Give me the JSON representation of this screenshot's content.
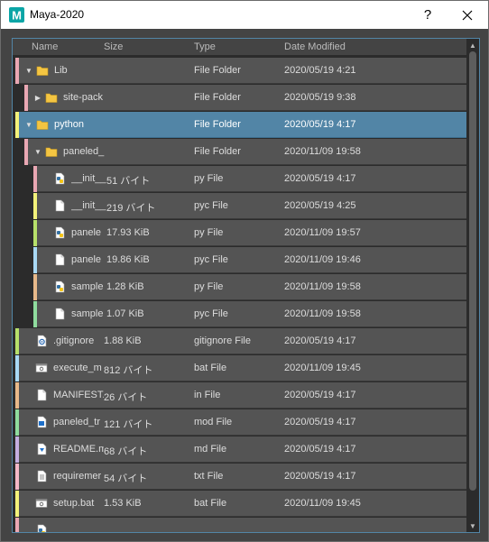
{
  "window": {
    "title": "Maya-2020",
    "help_label": "?",
    "app_icon_letter": "M"
  },
  "columns": {
    "name": "Name",
    "size": "Size",
    "type": "Type",
    "date": "Date Modified"
  },
  "colors": {
    "accent": "#5285a6",
    "row": "#545454",
    "background": "#444444"
  },
  "rows": [
    {
      "name": "Lib",
      "size": "",
      "type": "File Folder",
      "date": "2020/05/19 4:21",
      "depth": 0,
      "expand": "open",
      "icon": "folder-icon",
      "stripe": "#e9a7b3",
      "selected": false
    },
    {
      "name": "site-pack",
      "size": "",
      "type": "File Folder",
      "date": "2020/05/19 9:38",
      "depth": 1,
      "expand": "closed",
      "icon": "folder-icon",
      "stripe": "#e9a7b3",
      "selected": false
    },
    {
      "name": "python",
      "size": "",
      "type": "File Folder",
      "date": "2020/05/19 4:17",
      "depth": 0,
      "expand": "open",
      "icon": "folder-icon",
      "stripe": "#f3f27a",
      "selected": true
    },
    {
      "name": "paneled_",
      "size": "",
      "type": "File Folder",
      "date": "2020/11/09 19:58",
      "depth": 1,
      "expand": "open",
      "icon": "folder-icon",
      "stripe": "#e9a7b3",
      "selected": false
    },
    {
      "name": "__init__",
      "size": "51 バイト",
      "type": "py File",
      "date": "2020/05/19 4:17",
      "depth": 2,
      "expand": "none",
      "icon": "python-file-icon",
      "stripe": "#e9a7b3",
      "selected": false
    },
    {
      "name": "__init__",
      "size": "219 バイト",
      "type": "pyc File",
      "date": "2020/05/19 4:25",
      "depth": 2,
      "expand": "none",
      "icon": "file-icon",
      "stripe": "#f3f27a",
      "selected": false
    },
    {
      "name": "panele",
      "size": "17.93 KiB",
      "type": "py File",
      "date": "2020/11/09 19:57",
      "depth": 2,
      "expand": "none",
      "icon": "python-file-icon",
      "stripe": "#b7e06a",
      "selected": false
    },
    {
      "name": "panele",
      "size": "19.86 KiB",
      "type": "pyc File",
      "date": "2020/11/09 19:46",
      "depth": 2,
      "expand": "none",
      "icon": "file-icon",
      "stripe": "#a9d9f5",
      "selected": false
    },
    {
      "name": "sample",
      "size": "1.28 KiB",
      "type": "py File",
      "date": "2020/11/09 19:58",
      "depth": 2,
      "expand": "none",
      "icon": "python-file-icon",
      "stripe": "#e7b98a",
      "selected": false
    },
    {
      "name": "sample",
      "size": "1.07 KiB",
      "type": "pyc File",
      "date": "2020/11/09 19:58",
      "depth": 2,
      "expand": "none",
      "icon": "file-icon",
      "stripe": "#8fdc9e",
      "selected": false
    },
    {
      "name": ".gitignore",
      "size": "1.88 KiB",
      "type": "gitignore File",
      "date": "2020/05/19 4:17",
      "depth": 0,
      "expand": "none",
      "icon": "settings-file-icon",
      "stripe": "#b7e06a",
      "selected": false
    },
    {
      "name": "execute_m",
      "size": "812 バイト",
      "type": "bat File",
      "date": "2020/11/09 19:45",
      "depth": 0,
      "expand": "none",
      "icon": "batch-file-icon",
      "stripe": "#a9d9f5",
      "selected": false
    },
    {
      "name": "MANIFEST.",
      "size": "26 バイト",
      "type": "in File",
      "date": "2020/05/19 4:17",
      "depth": 0,
      "expand": "none",
      "icon": "file-icon",
      "stripe": "#e7b98a",
      "selected": false
    },
    {
      "name": "paneled_tr",
      "size": "121 バイト",
      "type": "mod File",
      "date": "2020/05/19 4:17",
      "depth": 0,
      "expand": "none",
      "icon": "mod-file-icon",
      "stripe": "#8fdc9e",
      "selected": false
    },
    {
      "name": "README.m",
      "size": "68 バイト",
      "type": "md File",
      "date": "2020/05/19 4:17",
      "depth": 0,
      "expand": "none",
      "icon": "markdown-file-icon",
      "stripe": "#c4aee0",
      "selected": false
    },
    {
      "name": "requiremer",
      "size": "54 バイト",
      "type": "txt File",
      "date": "2020/05/19 4:17",
      "depth": 0,
      "expand": "none",
      "icon": "text-file-icon",
      "stripe": "#f4b8c8",
      "selected": false
    },
    {
      "name": "setup.bat",
      "size": "1.53 KiB",
      "type": "bat File",
      "date": "2020/11/09 19:45",
      "depth": 0,
      "expand": "none",
      "icon": "batch-file-icon",
      "stripe": "#f3f27a",
      "selected": false
    },
    {
      "name": "",
      "size": "",
      "type": "",
      "date": "",
      "depth": 0,
      "expand": "none",
      "icon": "python-file-icon",
      "stripe": "#e9a7b3",
      "selected": false
    }
  ]
}
